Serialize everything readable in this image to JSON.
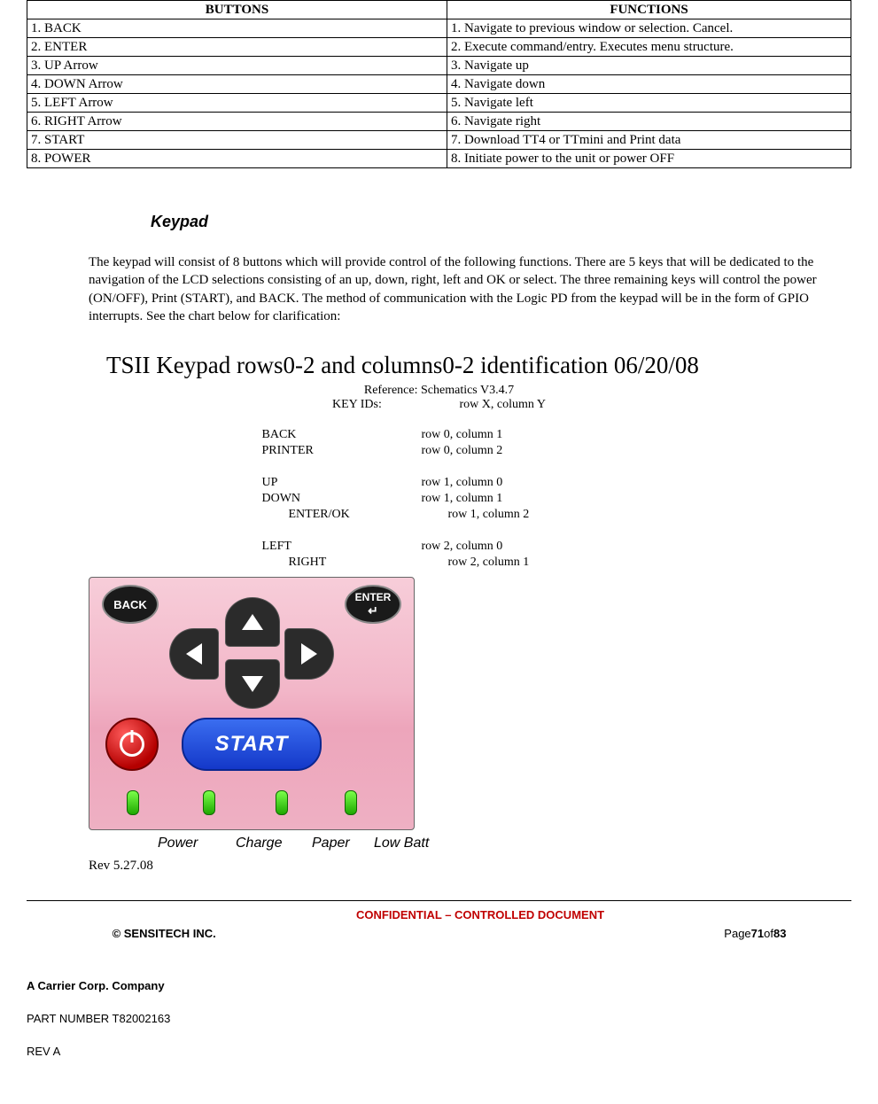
{
  "table": {
    "headers": {
      "buttons": "BUTTONS",
      "functions": "FUNCTIONS"
    },
    "rows": [
      {
        "button": "1. BACK",
        "function": "1. Navigate to previous window or selection. Cancel."
      },
      {
        "button": "2. ENTER",
        "function": "2. Execute command/entry. Executes menu structure."
      },
      {
        "button": "3. UP Arrow",
        "function": "3. Navigate up"
      },
      {
        "button": "4. DOWN Arrow",
        "function": "4. Navigate down"
      },
      {
        "button": "5. LEFT Arrow",
        "function": "5. Navigate left"
      },
      {
        "button": "6. RIGHT Arrow",
        "function": "6. Navigate right"
      },
      {
        "button": "7. START",
        "function": "7. Download TT4 or TTmini and Print data"
      },
      {
        "button": "8. POWER",
        "function": "8. Initiate power to the unit or power OFF"
      }
    ]
  },
  "section": {
    "keypad_heading": "Keypad",
    "paragraph": "The keypad will consist of 8 buttons which will provide control of the following functions.  There are 5 keys that will be dedicated to the navigation of the LCD selections consisting of an up, down, right, left and OK or select. The three remaining keys will control the power (ON/OFF), Print (START), and BACK. The method of communication with the Logic PD from the keypad will be in the form of GPIO interrupts. See the chart below for clarification:",
    "title2": "TSII Keypad rows0-2 and columns0-2 identification 06/20/08",
    "reference": "Reference:  Schematics V3.4.7",
    "keyids_label": "KEY IDs:",
    "keyids_value": "row X, column Y",
    "keymap": [
      {
        "name": "BACK",
        "pos": "row 0, column 1",
        "indent": false
      },
      {
        "name": "PRINTER",
        "pos": "row 0, column 2",
        "indent": false
      },
      {
        "name": "",
        "pos": "",
        "indent": false
      },
      {
        "name": "UP",
        "pos": "row 1, column 0",
        "indent": false
      },
      {
        "name": "DOWN",
        "pos": "row 1, column 1",
        "indent": false
      },
      {
        "name": "ENTER/OK",
        "pos": "row 1, column 2",
        "indent": true
      },
      {
        "name": "",
        "pos": "",
        "indent": false
      },
      {
        "name": "LEFT",
        "pos": "row 2, column 0",
        "indent": false
      },
      {
        "name": "RIGHT",
        "pos": "row 2, column 1",
        "indent": true
      }
    ]
  },
  "device": {
    "back_label": "BACK",
    "enter_label": "ENTER",
    "start_label": "START",
    "indicators": [
      "Power",
      "Charge",
      "Paper",
      "Low Batt"
    ]
  },
  "rev": "Rev 5.27.08",
  "footer": {
    "company": "© SENSITECH INC.",
    "confidential": "CONFIDENTIAL – CONTROLLED DOCUMENT",
    "page_prefix": "Page ",
    "page_current": "71",
    "page_of": " of ",
    "page_total": "83",
    "subcompany": "A Carrier Corp. Company",
    "partnumber": "PART NUMBER T82002163",
    "rev": "REV A"
  }
}
